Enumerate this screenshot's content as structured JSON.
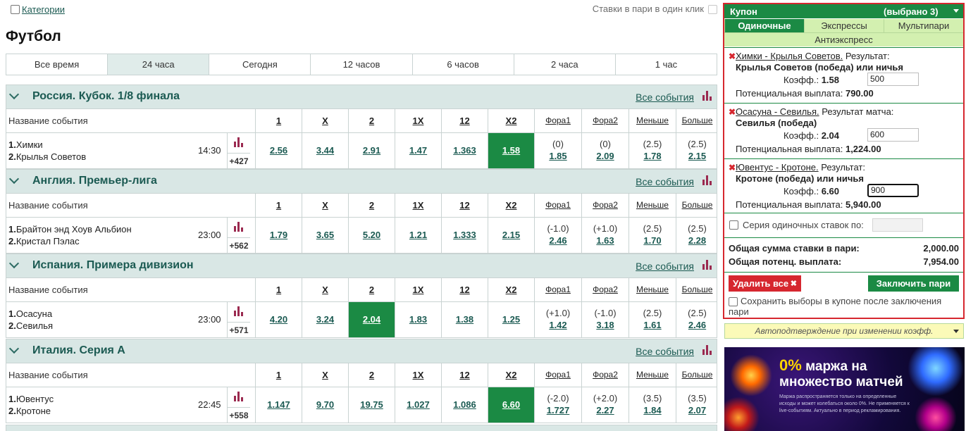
{
  "topbar": {
    "categories_label": "Категории",
    "oneclick_label": "Ставки в пари в один клик"
  },
  "page_title": "Футбол",
  "periods": [
    "Все время",
    "24 часа",
    "Сегодня",
    "12 часов",
    "6 часов",
    "2 часа",
    "1 час"
  ],
  "active_period": "24 часа",
  "headers": {
    "event_name": "Название события",
    "cols": [
      "1",
      "X",
      "2",
      "1X",
      "12",
      "X2",
      "Фора1",
      "Фора2",
      "Меньше",
      "Больше"
    ],
    "all_events": "Все события"
  },
  "leagues": [
    {
      "name": "Россия. Кубок. 1/8 финала",
      "event": {
        "team1_num": "1.",
        "team1": "Химки",
        "team2_num": "2.",
        "team2": "Крылья Советов",
        "time": "14:30",
        "more": "+427",
        "odds": [
          "2.56",
          "3.44",
          "2.91",
          "1.47",
          "1.363",
          "1.58"
        ],
        "selected": 5,
        "h1_param": "(0)",
        "h1": "1.85",
        "h2_param": "(0)",
        "h2": "2.09",
        "under_param": "(2.5)",
        "under": "1.78",
        "over_param": "(2.5)",
        "over": "2.15"
      }
    },
    {
      "name": "Англия. Премьер-лига",
      "event": {
        "team1_num": "1.",
        "team1": "Брайтон энд Хоув Альбион",
        "team2_num": "2.",
        "team2": "Кристал Пэлас",
        "time": "23:00",
        "more": "+562",
        "odds": [
          "1.79",
          "3.65",
          "5.20",
          "1.21",
          "1.333",
          "2.15"
        ],
        "selected": -1,
        "h1_param": "(-1.0)",
        "h1": "2.46",
        "h2_param": "(+1.0)",
        "h2": "1.63",
        "under_param": "(2.5)",
        "under": "1.70",
        "over_param": "(2.5)",
        "over": "2.28"
      }
    },
    {
      "name": "Испания. Примера дивизион",
      "event": {
        "team1_num": "1.",
        "team1": "Осасуна",
        "team2_num": "2.",
        "team2": "Севилья",
        "time": "23:00",
        "more": "+571",
        "odds": [
          "4.20",
          "3.24",
          "2.04",
          "1.83",
          "1.38",
          "1.25"
        ],
        "selected": 2,
        "h1_param": "(+1.0)",
        "h1": "1.42",
        "h2_param": "(-1.0)",
        "h2": "3.18",
        "under_param": "(2.5)",
        "under": "1.61",
        "over_param": "(2.5)",
        "over": "2.46"
      }
    },
    {
      "name": "Италия. Серия А",
      "event": {
        "team1_num": "1.",
        "team1": "Ювентус",
        "team2_num": "2.",
        "team2": "Кротоне",
        "time": "22:45",
        "more": "+558",
        "odds": [
          "1.147",
          "9.70",
          "19.75",
          "1.027",
          "1.086",
          "6.60"
        ],
        "selected": 5,
        "h1_param": "(-2.0)",
        "h1": "1.727",
        "h2_param": "(+2.0)",
        "h2": "2.27",
        "under_param": "(3.5)",
        "under": "1.84",
        "over_param": "(3.5)",
        "over": "2.07"
      }
    }
  ],
  "coupon": {
    "title": "Купон",
    "selected_count": "(выбрано 3)",
    "tabs": [
      "Одиночные",
      "Экспрессы",
      "Мультипари"
    ],
    "anti": "Антиэкспресс",
    "coef_label": "Коэфф.:",
    "payout_label": "Потенциальная выплата:",
    "bets": [
      {
        "match": "Химки - Крылья Советов.",
        "market": "Результат:",
        "outcome": "Крылья Советов (победа) или ничья",
        "coef": "1.58",
        "stake": "500",
        "payout": "790.00"
      },
      {
        "match": "Осасуна - Севилья.",
        "market": "Результат матча:",
        "outcome": "Севилья (победа)",
        "coef": "2.04",
        "stake": "600",
        "payout": "1,224.00"
      },
      {
        "match": "Ювентус - Кротоне.",
        "market": "Результат:",
        "outcome": "Кротоне (победа) или ничья",
        "coef": "6.60",
        "stake": "900",
        "payout": "5,940.00"
      }
    ],
    "series_label": "Серия одиночных ставок по:",
    "total_stake_label": "Общая сумма ставки в пари:",
    "total_stake": "2,000.00",
    "total_payout_label": "Общая потенц. выплата:",
    "total_payout": "7,954.00",
    "delete_all": "Удалить все",
    "place_bet": "Заключить пари",
    "save_label": "Сохранить выборы в купоне после заключения пари"
  },
  "auto_confirm": "Автоподтверждение при изменении коэфф.",
  "banner": {
    "percent": "0%",
    "headline1": " маржа на",
    "headline2": "множество матчей",
    "small": "Маржа распространяется только на определенные исходы и может колебаться около 0%. Не применяется к live-событиям. Актуально в период рекламирования."
  },
  "colors": {
    "accent_green": "#1b8a44",
    "coupon_border": "#d6272f",
    "link": "#1b5a52",
    "header_bg": "#d9e7e5"
  }
}
